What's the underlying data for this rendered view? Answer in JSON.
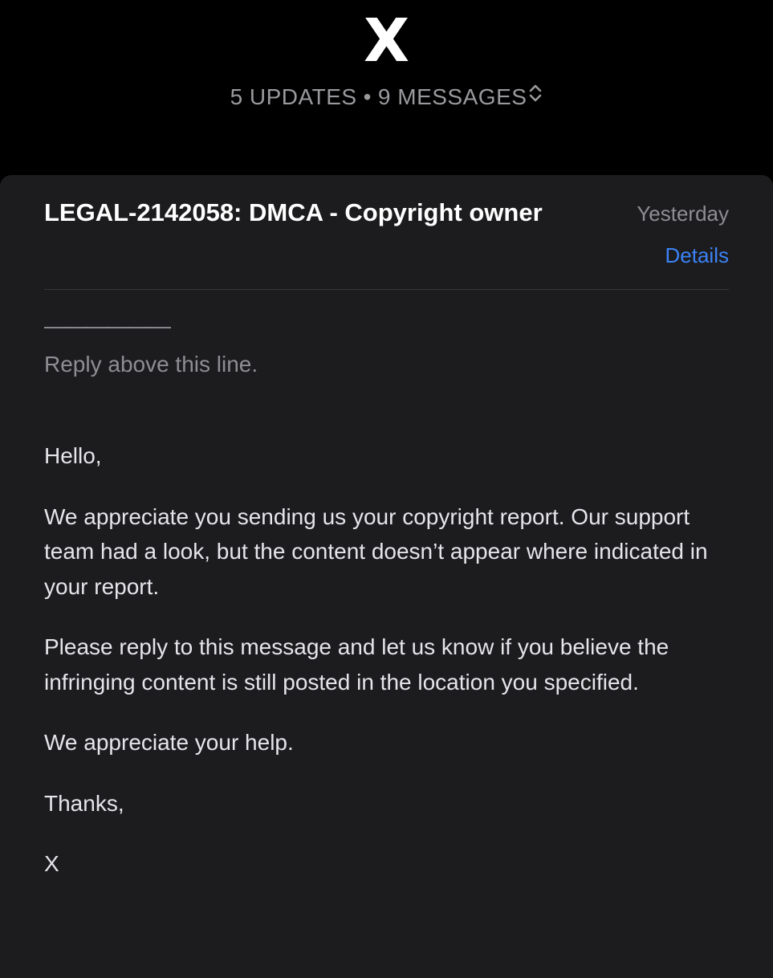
{
  "header": {
    "sender_logo": "X",
    "updates": "5 UPDATES",
    "separator": "•",
    "messages": "9 MESSAGES",
    "expand_icon": "chevron-up-down-icon"
  },
  "email": {
    "subject": "LEGAL-2142058: DMCA - Copyright owner",
    "date": "Yesterday",
    "details_link": "Details",
    "dashes": "——————",
    "reply_line": "Reply above this line.",
    "greeting": "Hello,",
    "paragraph_1": "We appreciate you sending us your copyright report. Our support team had a look, but the content doesn’t appear where indicated in your report.",
    "paragraph_2": "Please reply to this message and let us know if you believe the infringing content is still posted in the location you specified.",
    "paragraph_3": "We appreciate your help.",
    "signoff": "Thanks,",
    "signature": "X"
  },
  "colors": {
    "background": "#000000",
    "card": "#1c1c1e",
    "link": "#3b82f6",
    "muted": "#8e8e93",
    "text": "#e5e5ea"
  }
}
